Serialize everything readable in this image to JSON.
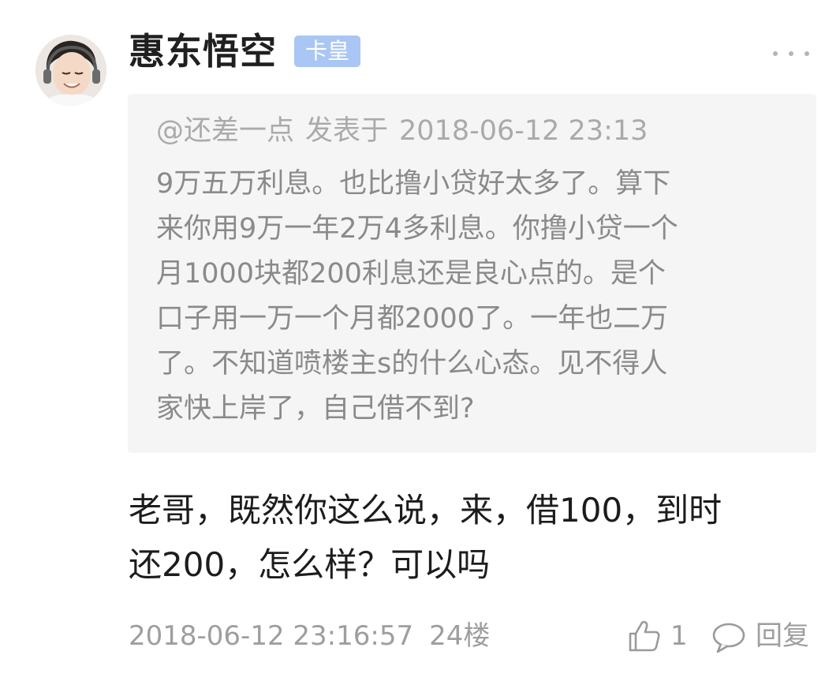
{
  "post": {
    "author": {
      "name": "惠东悟空",
      "badge": "卡皇",
      "avatar_icon": "user-avatar-photo"
    },
    "more_icon": "more-dots-icon",
    "quote": {
      "author": "@还差一点",
      "posted_label": "发表于",
      "datetime": "2018-06-12 23:13",
      "text": "9万五万利息。也比撸小贷好太多了。算下\n来你用9万一年2万4多利息。你撸小贷一个\n月1000块都200利息还是良心点的。是个\n口子用一万一个月都2000了。一年也二万\n了。不知道喷楼主s的什么心态。见不得人\n家快上岸了，自己借不到?"
    },
    "reply": {
      "text": "老哥，既然你这么说，来，借100，到时\n还200，怎么样？可以吗"
    },
    "meta": {
      "datetime": "2018-06-12 23:16:57",
      "floor": "24楼"
    },
    "actions": {
      "like_icon": "thumbs-up-icon",
      "like_count": "1",
      "reply_icon": "comment-bubble-icon",
      "reply_label": "回复"
    }
  }
}
